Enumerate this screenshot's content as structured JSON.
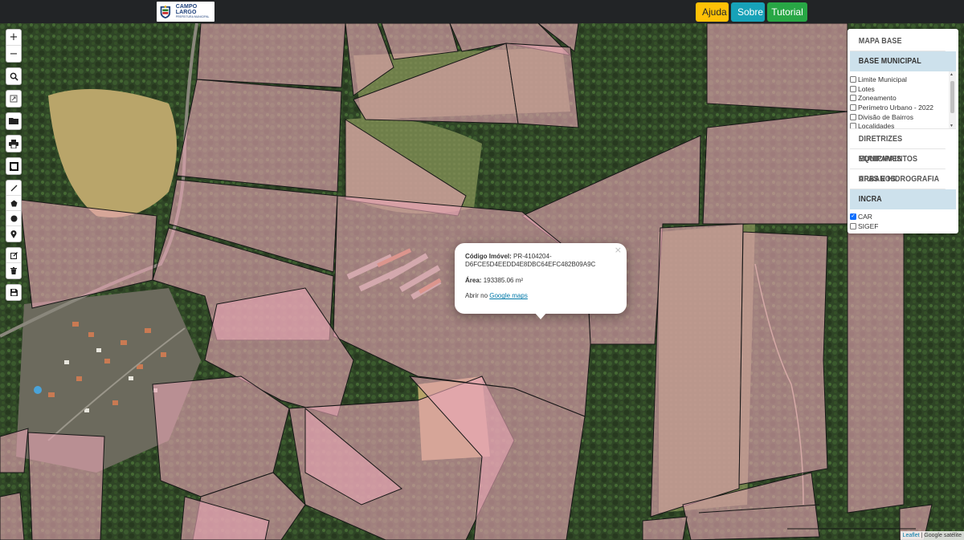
{
  "header": {
    "logo_title": "CAMPO LARGO",
    "logo_subtitle": "PREFEITURA MUNICIPAL",
    "buttons": {
      "ajuda": "Ajuda",
      "sobre": "Sobre",
      "tutorial": "Tutorial"
    }
  },
  "toolbar": {
    "zoom_in": "+",
    "zoom_out": "−",
    "icons": [
      "search-icon",
      "zoom-extent-icon",
      "folder-open-icon",
      "print-icon",
      "square-select-icon",
      "draw-line-icon",
      "draw-polygon-icon",
      "draw-circle-icon",
      "draw-marker-icon",
      "edit-icon",
      "delete-icon",
      "save-icon"
    ]
  },
  "layers_panel": {
    "sections": {
      "mapa_base": "MAPA BASE",
      "base_municipal": "BASE MUNICIPAL",
      "diretrizes": "DIRETRIZES MUNICIPAIS",
      "equipamentos": "EQUIPAMENTOS URBANOS",
      "apas": "APAS E HIDROGRAFIA",
      "incra": "INCRA"
    },
    "base_municipal_layers": [
      {
        "label": "Limite Municipal",
        "checked": false
      },
      {
        "label": "Lotes",
        "checked": false
      },
      {
        "label": "Zoneamento",
        "checked": false
      },
      {
        "label": "Perímetro Urbano - 2022",
        "checked": false
      },
      {
        "label": "Divisão de Bairros",
        "checked": false
      },
      {
        "label": "Localidades",
        "checked": false
      }
    ],
    "incra_layers": [
      {
        "label": "CAR",
        "checked": true
      },
      {
        "label": "SIGEF",
        "checked": false
      }
    ]
  },
  "popup": {
    "codigo_label": "Código Imóvel:",
    "codigo_value": "PR-4104204-",
    "codigo_value_2": "D6FCE5D4EEDD4E8DBC64EFC482B09A9C",
    "area_label": "Área:",
    "area_value": "193385.06 m²",
    "abrir_text": "Abrir no",
    "link_text": "Google maps",
    "close": "×"
  },
  "attribution": {
    "leaflet": "Leaflet",
    "separator": " | ",
    "source": "Google satélite"
  },
  "colors": {
    "parcel_fill": "#e8a6b4",
    "parcel_stroke": "#1a1a1a",
    "ajuda": "#ffc107",
    "sobre": "#17a2b8",
    "tutorial": "#28a745",
    "active_section": "#cde1ec"
  }
}
